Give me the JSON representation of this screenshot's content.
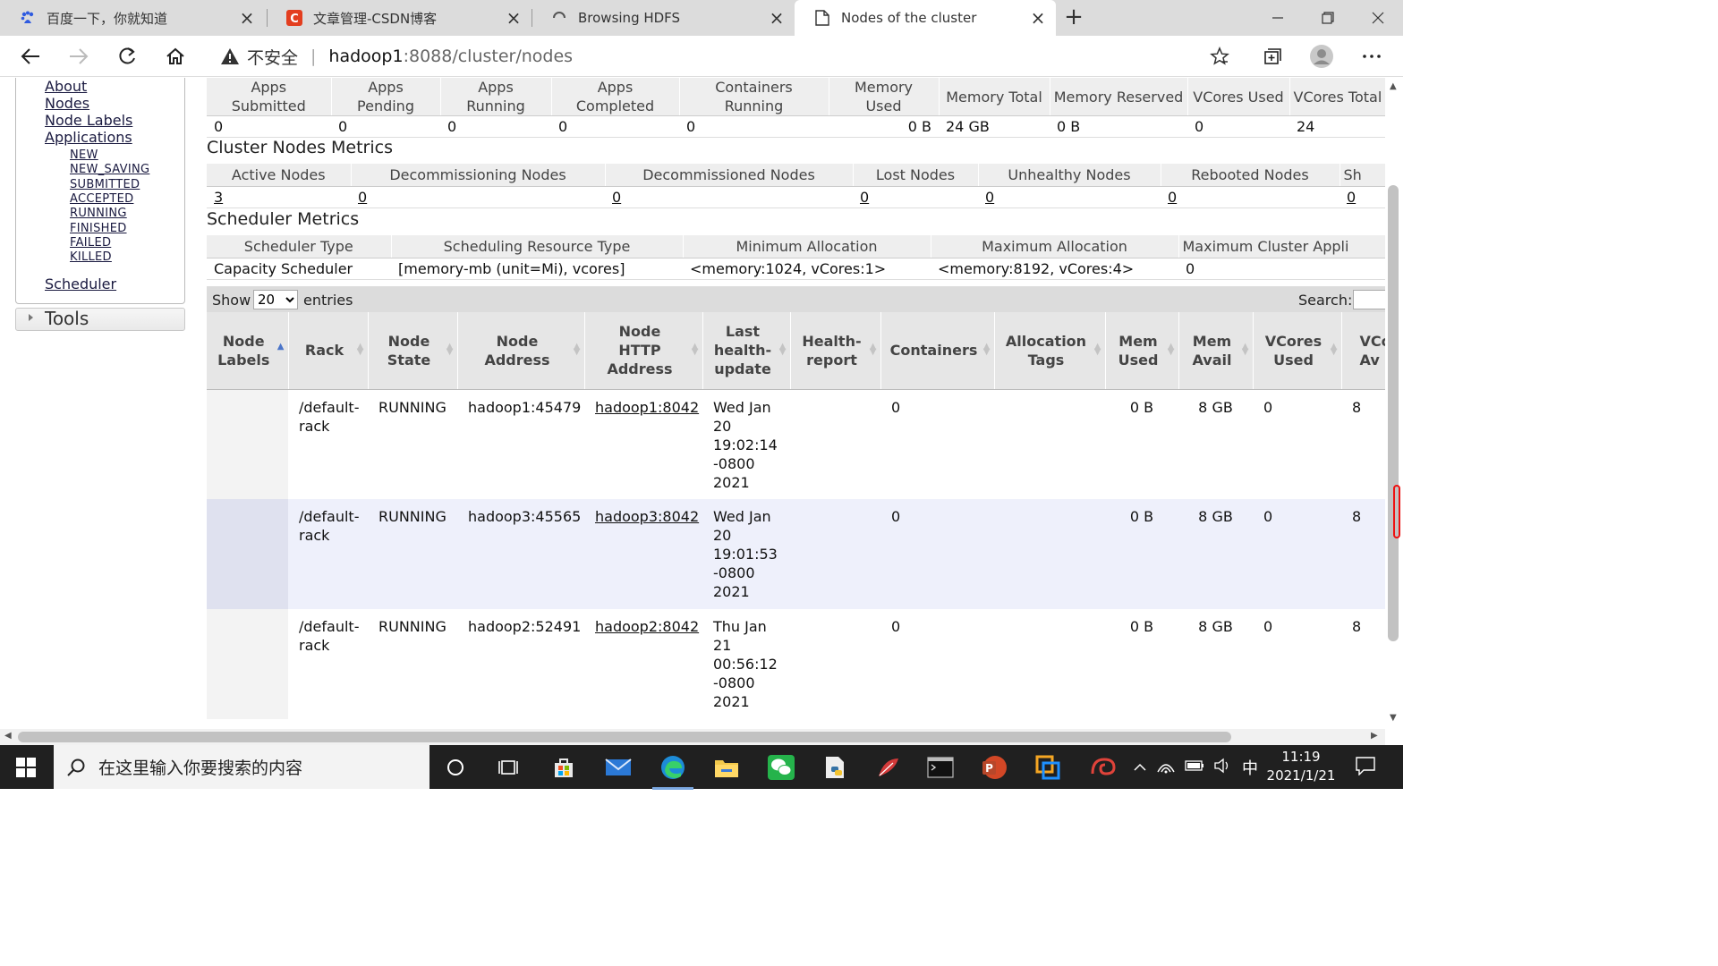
{
  "browser": {
    "tabs": [
      {
        "title": "百度一下，你就知道",
        "icon": "baidu-paw-icon",
        "active": false
      },
      {
        "title": "文章管理-CSDN博客",
        "icon": "csdn-icon",
        "active": false
      },
      {
        "title": "Browsing HDFS",
        "icon": "loading-spinner-icon",
        "active": false
      },
      {
        "title": "Nodes of the cluster",
        "icon": "page-icon",
        "active": true
      }
    ],
    "address": {
      "insecure_label": "不安全",
      "host": "hadoop1",
      "path": ":8088/cluster/nodes"
    }
  },
  "sidebar": {
    "top_links": [
      "About",
      "Nodes",
      "Node Labels",
      "Applications"
    ],
    "app_states": [
      "NEW",
      "NEW_SAVING",
      "SUBMITTED",
      "ACCEPTED",
      "RUNNING",
      "FINISHED",
      "FAILED",
      "KILLED"
    ],
    "scheduler_link": "Scheduler",
    "tools_label": "Tools"
  },
  "cluster_metrics": {
    "headers": [
      "Apps Submitted",
      "Apps Pending",
      "Apps Running",
      "Apps Completed",
      "Containers Running",
      "Memory Used",
      "Memory Total",
      "Memory Reserved",
      "VCores Used",
      "VCores Total"
    ],
    "values": [
      "0",
      "0",
      "0",
      "0",
      "0",
      "0 B",
      "24 GB",
      "0 B",
      "0",
      "24"
    ]
  },
  "cluster_nodes_metrics": {
    "title": "Cluster Nodes Metrics",
    "headers": [
      "Active Nodes",
      "Decommissioning Nodes",
      "Decommissioned Nodes",
      "Lost Nodes",
      "Unhealthy Nodes",
      "Rebooted Nodes",
      "Sh"
    ],
    "values": [
      "3",
      "0",
      "0",
      "0",
      "0",
      "0",
      "0"
    ]
  },
  "scheduler_metrics": {
    "title": "Scheduler Metrics",
    "headers": [
      "Scheduler Type",
      "Scheduling Resource Type",
      "Minimum Allocation",
      "Maximum Allocation",
      "Maximum Cluster Appli"
    ],
    "values": [
      "Capacity Scheduler",
      "[memory-mb (unit=Mi), vcores]",
      "<memory:1024, vCores:1>",
      "<memory:8192, vCores:4>",
      "0"
    ]
  },
  "nodes_table": {
    "show_label": "Show",
    "page_size": "20",
    "entries_label": "entries",
    "search_label": "Search:",
    "headers": [
      "Node Labels",
      "Rack",
      "Node State",
      "Node Address",
      "Node HTTP Address",
      "Last health-update",
      "Health-report",
      "Containers",
      "Allocation Tags",
      "Mem Used",
      "Mem Avail",
      "VCores Used",
      "VCo Av"
    ],
    "rows": [
      {
        "labels": "",
        "rack": "/default-rack",
        "state": "RUNNING",
        "address": "hadoop1:45479",
        "http": "hadoop1:8042",
        "last_update": "Wed Jan 20 19:02:14 -0800 2021",
        "health": "",
        "containers": "0",
        "tags": "",
        "mem_used": "0 B",
        "mem_avail": "8 GB",
        "vcores_used": "0",
        "vcores_avail": "8"
      },
      {
        "labels": "",
        "rack": "/default-rack",
        "state": "RUNNING",
        "address": "hadoop3:45565",
        "http": "hadoop3:8042",
        "last_update": "Wed Jan 20 19:01:53 -0800 2021",
        "health": "",
        "containers": "0",
        "tags": "",
        "mem_used": "0 B",
        "mem_avail": "8 GB",
        "vcores_used": "0",
        "vcores_avail": "8"
      },
      {
        "labels": "",
        "rack": "/default-rack",
        "state": "RUNNING",
        "address": "hadoop2:52491",
        "http": "hadoop2:8042",
        "last_update": "Thu Jan 21 00:56:12 -0800 2021",
        "health": "",
        "containers": "0",
        "tags": "",
        "mem_used": "0 B",
        "mem_avail": "8 GB",
        "vcores_used": "0",
        "vcores_avail": "8"
      }
    ]
  },
  "taskbar": {
    "search_placeholder": "在这里输入你要搜索的内容",
    "ime": "中",
    "time": "11:19",
    "date": "2021/1/21"
  }
}
